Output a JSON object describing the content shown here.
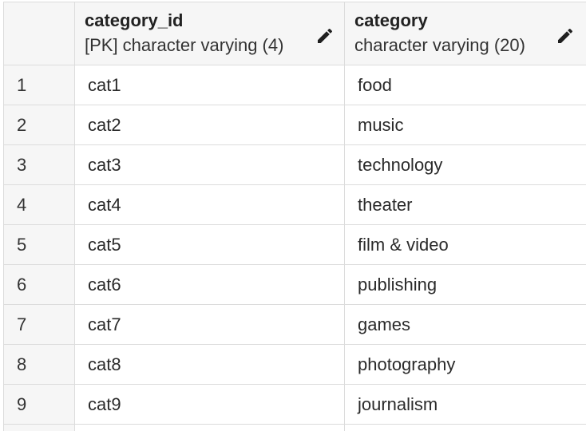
{
  "columns": [
    {
      "name": "category_id",
      "type": "[PK] character varying (4)",
      "edit_icon": "pencil-icon"
    },
    {
      "name": "category",
      "type": "character varying (20)",
      "edit_icon": "pencil-icon"
    }
  ],
  "rows": [
    {
      "num": "1",
      "category_id": "cat1",
      "category": "food"
    },
    {
      "num": "2",
      "category_id": "cat2",
      "category": "music"
    },
    {
      "num": "3",
      "category_id": "cat3",
      "category": "technology"
    },
    {
      "num": "4",
      "category_id": "cat4",
      "category": "theater"
    },
    {
      "num": "5",
      "category_id": "cat5",
      "category": "film & video"
    },
    {
      "num": "6",
      "category_id": "cat6",
      "category": "publishing"
    },
    {
      "num": "7",
      "category_id": "cat7",
      "category": "games"
    },
    {
      "num": "8",
      "category_id": "cat8",
      "category": "photography"
    },
    {
      "num": "9",
      "category_id": "cat9",
      "category": "journalism"
    }
  ],
  "colors": {
    "header_bg": "#f6f6f6",
    "grid_line": "#dcdcdc",
    "text": "#222222"
  }
}
